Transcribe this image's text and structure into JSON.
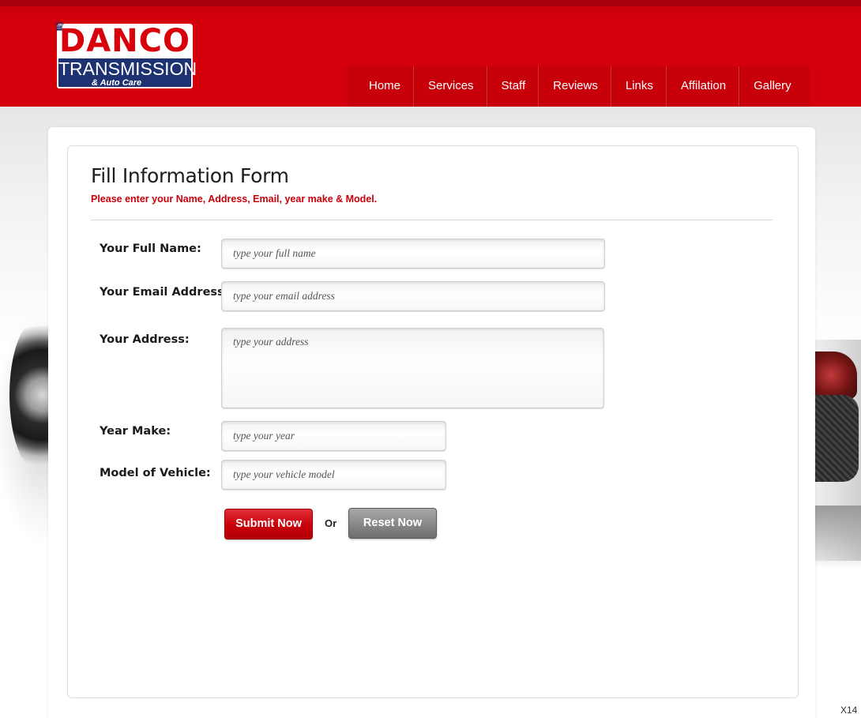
{
  "logo": {
    "line1": "DANCO",
    "line2": "TRANSMISSION",
    "line3": "& Auto Care"
  },
  "nav": {
    "items": [
      {
        "label": "Home"
      },
      {
        "label": "Services"
      },
      {
        "label": "Staff"
      },
      {
        "label": "Reviews"
      },
      {
        "label": "Links"
      },
      {
        "label": "Affilation"
      },
      {
        "label": "Gallery"
      }
    ]
  },
  "form": {
    "title": "Fill Information Form",
    "subtitle": "Please enter your Name, Address, Email, year make & Model.",
    "fields": [
      {
        "label": "Your Full Name:",
        "placeholder": "type your full name"
      },
      {
        "label": "Your Email Address:",
        "placeholder": "type your email address"
      },
      {
        "label": "Your Address:",
        "placeholder": "type your address"
      },
      {
        "label": "Year Make:",
        "placeholder": "type your year"
      },
      {
        "label": "Model of Vehicle:",
        "placeholder": "type your vehicle model"
      }
    ],
    "submit_label": "Submit Now",
    "or_label": "Or",
    "reset_label": "Reset Now"
  },
  "corner_tag": "X14",
  "colors": {
    "brand_red": "#d3000b",
    "logo_blue": "#1e3170",
    "reset_gray": "#8a8a8a"
  }
}
